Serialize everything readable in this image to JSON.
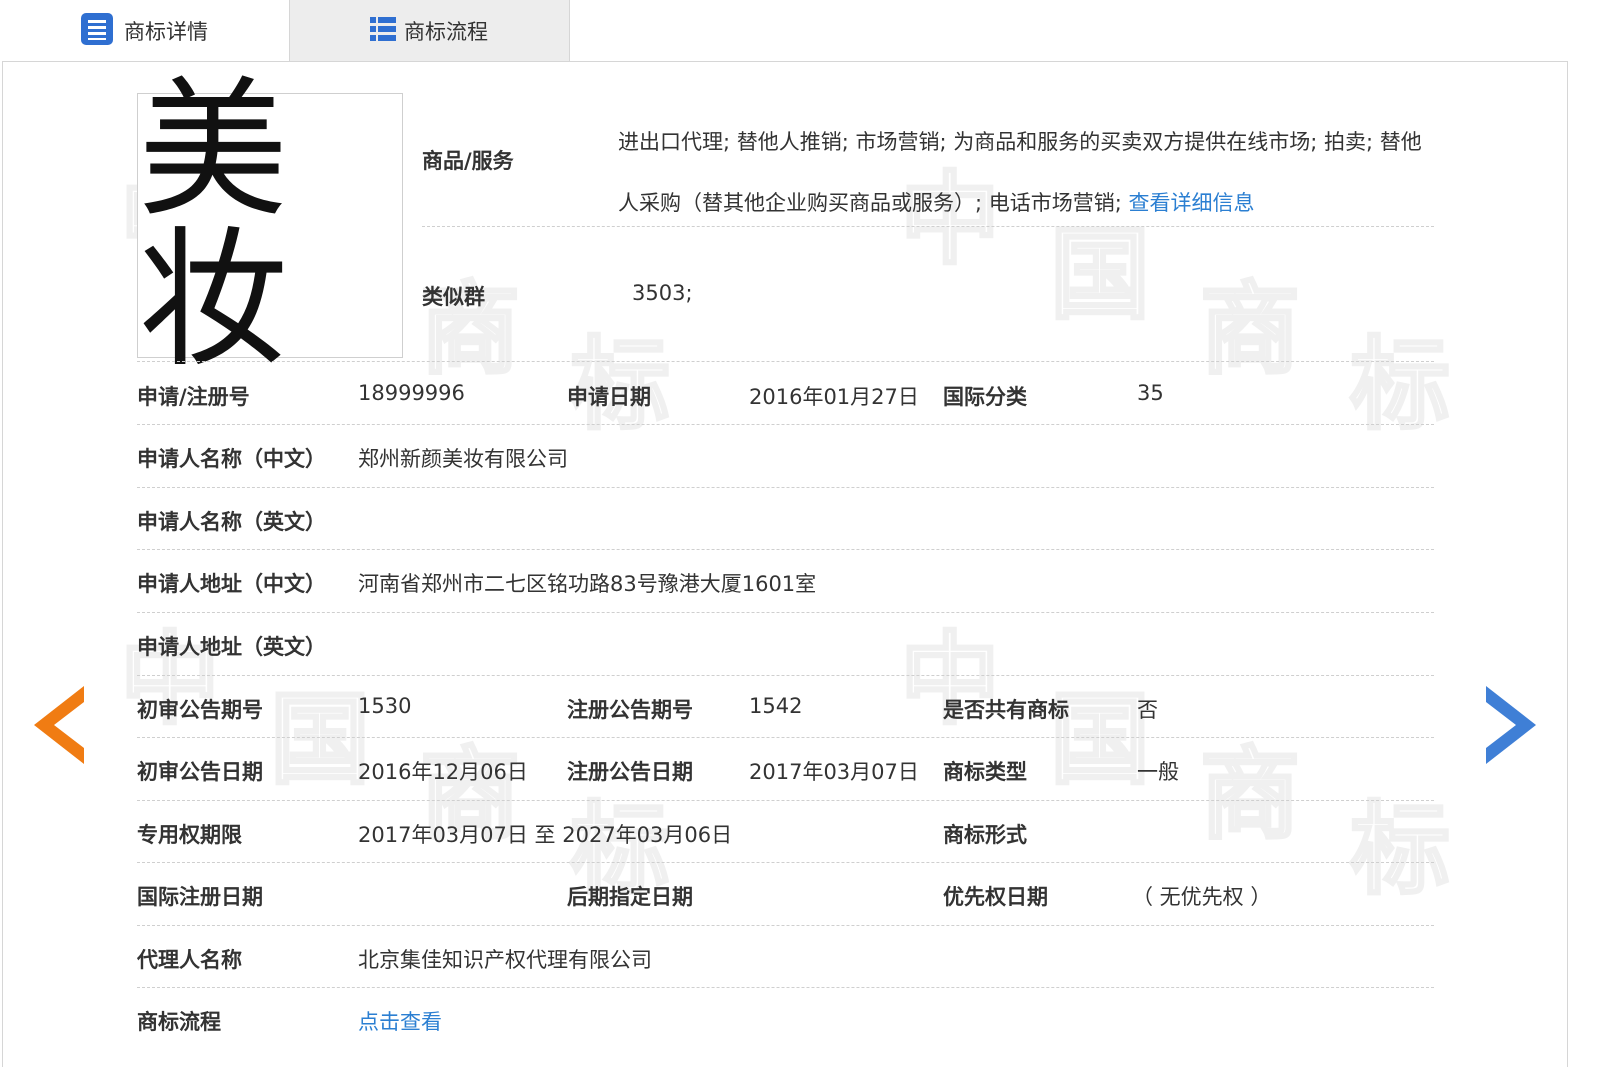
{
  "tabs": [
    {
      "label": "商标详情",
      "icon": "document-list-icon",
      "active": true
    },
    {
      "label": "商标流程",
      "icon": "list-icon",
      "active": false
    }
  ],
  "logo": {
    "text": "美妆"
  },
  "watermark": {
    "chars": [
      "中",
      "国",
      "商",
      "标"
    ]
  },
  "goods": {
    "label": "商品/服务",
    "text": "进出口代理; 替他人推销; 市场营销; 为商品和服务的买卖双方提供在线市场; 拍卖; 替他人采购（替其他企业购买商品或服务）; 电话市场营销;",
    "link": "查看详细信息"
  },
  "similar_group": {
    "label": "类似群",
    "value": "3503;"
  },
  "rows": {
    "reg_no": {
      "label": "申请/注册号",
      "value": "18999996"
    },
    "apply_date": {
      "label": "申请日期",
      "value": "2016年01月27日"
    },
    "intl_class": {
      "label": "国际分类",
      "value": "35"
    },
    "applicant_cn": {
      "label": "申请人名称（中文）",
      "value": "郑州新颜美妆有限公司"
    },
    "applicant_en": {
      "label": "申请人名称（英文）",
      "value": ""
    },
    "address_cn": {
      "label": "申请人地址（中文）",
      "value": "河南省郑州市二七区铭功路83号豫港大厦1601室"
    },
    "address_en": {
      "label": "申请人地址（英文）",
      "value": ""
    },
    "prelim_issue": {
      "label": "初审公告期号",
      "value": "1530"
    },
    "reg_issue": {
      "label": "注册公告期号",
      "value": "1542"
    },
    "shared": {
      "label": "是否共有商标",
      "value": "否"
    },
    "prelim_date": {
      "label": "初审公告日期",
      "value": "2016年12月06日"
    },
    "reg_date": {
      "label": "注册公告日期",
      "value": "2017年03月07日"
    },
    "mark_type": {
      "label": "商标类型",
      "value": "一般"
    },
    "exclusive": {
      "label": "专用权期限",
      "value": "2017年03月07日 至 2027年03月06日"
    },
    "mark_form": {
      "label": "商标形式",
      "value": ""
    },
    "intl_reg_date": {
      "label": "国际注册日期",
      "value": ""
    },
    "later_date": {
      "label": "后期指定日期",
      "value": ""
    },
    "priority_date": {
      "label": "优先权日期",
      "value": "（ 无优先权 ）"
    },
    "agent": {
      "label": "代理人名称",
      "value": "北京集佳知识产权代理有限公司"
    },
    "process": {
      "label": "商标流程",
      "link": "点击查看"
    }
  },
  "nav": {
    "prev_icon": "chevron-left-icon",
    "next_icon": "chevron-right-icon",
    "prev_color": "#f07c13",
    "next_color": "#3f7fd6"
  },
  "colors": {
    "link": "#2b7fd2",
    "tab_icon": "#2f6fd1",
    "inactive_tab_bg": "#ededed"
  }
}
